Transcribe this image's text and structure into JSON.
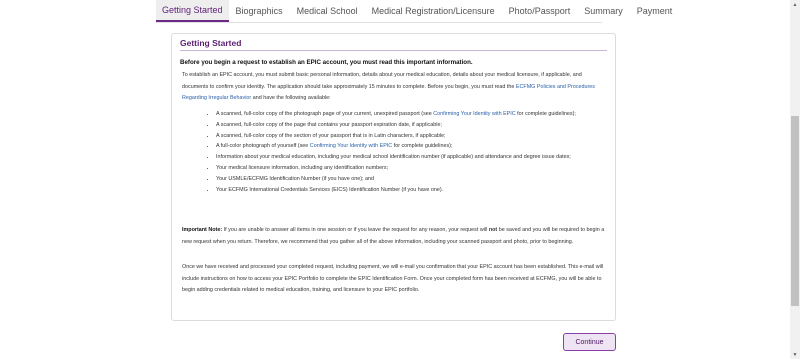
{
  "tabs": [
    {
      "label": "Getting Started",
      "active": true
    },
    {
      "label": "Biographics",
      "active": false
    },
    {
      "label": "Medical School",
      "active": false
    },
    {
      "label": "Medical Registration/Licensure",
      "active": false
    },
    {
      "label": "Photo/Passport",
      "active": false
    },
    {
      "label": "Summary",
      "active": false
    },
    {
      "label": "Payment",
      "active": false
    }
  ],
  "panel": {
    "title": "Getting Started",
    "lead": "Before you begin a request to establish an EPIC account, you must read this important information.",
    "intro_before_link": "To establish an EPIC account, you must submit basic personal information, details about your medical education, details about your medical licensure, if applicable, and documents to confirm your identity. The application should take approximately 15 minutes to complete. Before you begin, you must read the ",
    "intro_link": "ECFMG Policies and Procedures Regarding Irregular Behavior",
    "intro_after_link": " and have the following available:",
    "items": {
      "i1_before": "A scanned, full-color copy of the photograph page of your current, unexpired passport (see ",
      "i1_link": "Confirming Your Identity with EPIC",
      "i1_after": " for complete guidelines);",
      "i2": "A scanned, full-color copy of the page that contains your passport expiration date, if applicable;",
      "i3": "A scanned, full-color copy of the section of your passport that is in Latin characters, if applicable;",
      "i4_before": "A full-color photograph of yourself (see ",
      "i4_link": "Confirming Your Identity with EPIC",
      "i4_after": " for complete guidelines);",
      "i5": "Information about your medical education, including your medical school identification number (if applicable) and attendance and degree issue dates;",
      "i6": "Your medical licensure information, including any identification numbers;",
      "i7": "Your USMLE/ECFMG Identification Number (if you have one); and",
      "i8": "Your ECFMG International Credentials Services (EICS) Identification Number (if you have one)."
    },
    "note_label": "Important Note:",
    "note_text_1": " If you are unable to answer all items in one session or if you leave the request for any reason, your request will ",
    "note_not": "not",
    "note_text_2": " be saved and you will be required to begin a new request when you return. Therefore, we recommend that you gather all of the above information, including your scanned passport and photo, prior to beginning.",
    "closing": "Once we have received and processed your completed request, including payment, we will e-mail you confirmation that your EPIC account has been established. This e-mail will include instructions on how to access your EPIC Portfolio to complete the EPIC Identification Form. Once your completed form has been received at ECFMG, you will be able to begin adding credentials related to medical education, training, and licensure to your EPIC portfolio."
  },
  "buttons": {
    "continue": "Continue"
  },
  "colors": {
    "accent": "#5b1f74",
    "link": "#2a5fa8",
    "button_bg": "#efe4f3"
  },
  "icons": {
    "scroll_up": "arrow-up-icon",
    "scroll_down": "arrow-down-icon"
  }
}
